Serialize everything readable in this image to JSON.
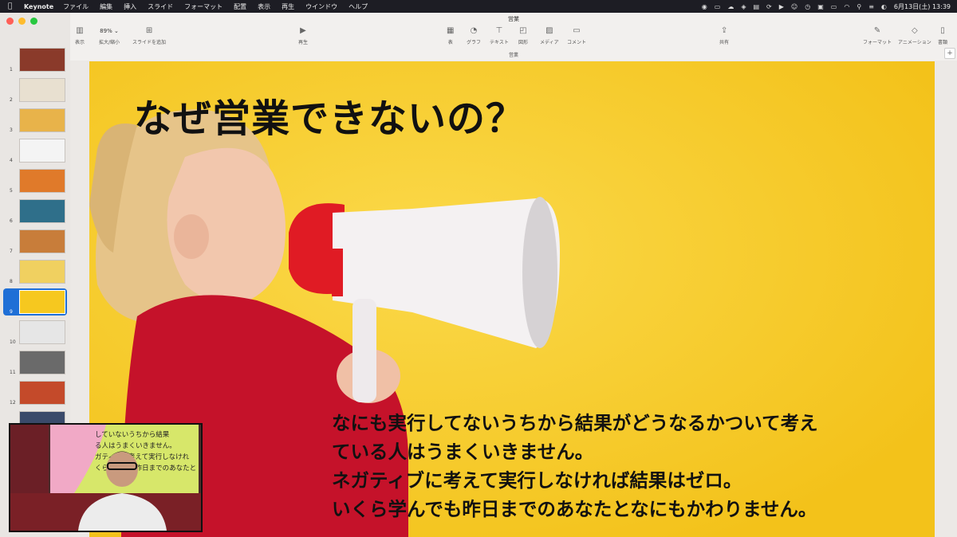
{
  "menubar": {
    "app_name": "Keynote",
    "menu": [
      "ファイル",
      "編集",
      "挿入",
      "スライド",
      "フォーマット",
      "配置",
      "表示",
      "再生",
      "ウインドウ",
      "ヘルプ"
    ],
    "clock": "6月13日(土)  13:39"
  },
  "window": {
    "title": "営業",
    "subtitle": "営業"
  },
  "toolbar": {
    "view_label": "表示",
    "zoom_value": "89%",
    "zoom_label": "拡大/縮小",
    "add_slide_label": "スライドを追加",
    "play_label": "再生",
    "table_label": "表",
    "chart_label": "グラフ",
    "text_label": "テキスト",
    "shape_label": "図形",
    "media_label": "メディア",
    "comment_label": "コメント",
    "share_label": "共有",
    "format_label": "フォーマット",
    "animate_label": "アニメーション",
    "document_label": "書類"
  },
  "navigator": {
    "selected": 9,
    "slides": [
      {
        "num": "1",
        "color": "#8a3a2a"
      },
      {
        "num": "2",
        "color": "#e8e0d0"
      },
      {
        "num": "3",
        "color": "#e8b34a"
      },
      {
        "num": "4",
        "color": "#f4f4f4"
      },
      {
        "num": "5",
        "color": "#e07a2a"
      },
      {
        "num": "6",
        "color": "#2f6f8a"
      },
      {
        "num": "7",
        "color": "#c87d3a"
      },
      {
        "num": "8",
        "color": "#f0d060"
      },
      {
        "num": "9",
        "color": "#f6c81f"
      },
      {
        "num": "10",
        "color": "#e6e6e6"
      },
      {
        "num": "11",
        "color": "#6a6a6a"
      },
      {
        "num": "12",
        "color": "#c44a2a"
      },
      {
        "num": "13",
        "color": "#3a4a6a"
      }
    ]
  },
  "slide": {
    "title": "なぜ営業できないの？",
    "body": [
      "なにも実行してないうちから結果がどうなるかついて考え",
      "ている人はうまくいきません。",
      "ネガティブに考えて実行しなければ結果はゼロ。",
      "いくら学んでも昨日までのあなたとなにもかわりません。"
    ]
  },
  "webcam": {
    "screen_lines": [
      "していないうちから結果",
      "る人はうまくいきません。",
      "ガティブに考えて実行しなけれ",
      "くら学んでも昨日までのあなたと"
    ]
  }
}
